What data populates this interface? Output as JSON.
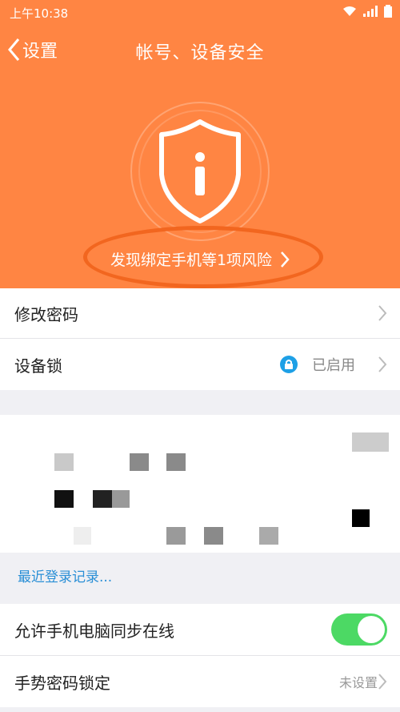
{
  "status_bar": {
    "time": "上午10:38",
    "battery": "▮"
  },
  "nav": {
    "back_label": "设置",
    "title": "帐号、设备安全"
  },
  "risk": {
    "text": "发现绑定手机等1项风险"
  },
  "rows": {
    "change_password": {
      "label": "修改密码"
    },
    "device_lock": {
      "label": "设备锁",
      "status": "已启用"
    }
  },
  "recent_login_link": "最近登录记录...",
  "sync_online": {
    "label": "允许手机电脑同步在线",
    "enabled": true
  },
  "gesture_lock": {
    "label": "手势密码锁定",
    "value": "未设置"
  },
  "colors": {
    "hero": "#ff8543",
    "accent_link": "#2a8fd6",
    "toggle_on": "#4cd964",
    "lock_icon": "#1ea0e6"
  }
}
